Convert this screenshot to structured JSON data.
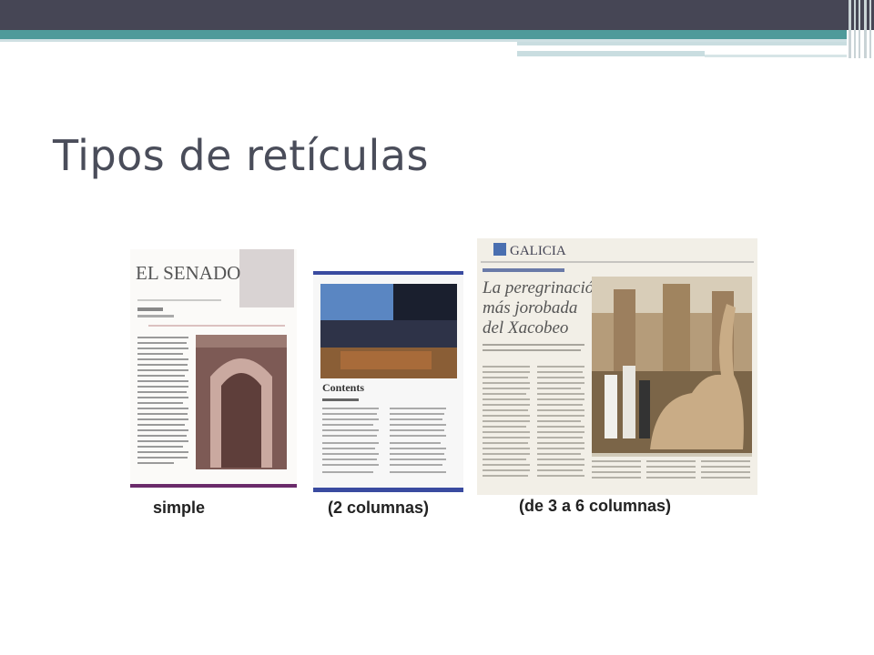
{
  "slide": {
    "title": "Tipos de retículas"
  },
  "examples": [
    {
      "masthead": "EL SENADO",
      "caption": "simple"
    },
    {
      "heading": "Contents",
      "caption": "(2 columnas)"
    },
    {
      "masthead": "GALICIA",
      "headline_l1": "La peregrinación",
      "headline_l2": "más jorobada",
      "headline_l3": "del Xacobeo",
      "caption": "(de 3 a 6 columnas)"
    }
  ],
  "colors": {
    "header_dark": "#464655",
    "header_teal": "#4f9a9a",
    "title_text": "#4a4d5a"
  }
}
